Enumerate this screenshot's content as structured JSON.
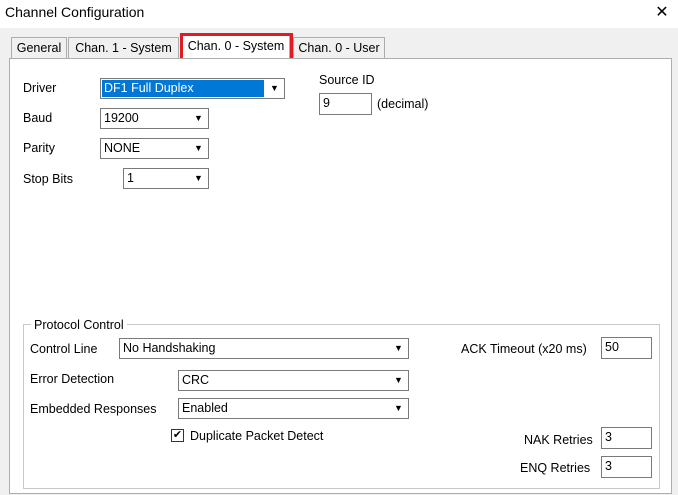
{
  "window": {
    "title": "Channel Configuration",
    "close_glyph": "✕"
  },
  "tabs": [
    {
      "label": "General"
    },
    {
      "label": "Chan. 1 - System"
    },
    {
      "label": "Chan. 0 - System",
      "active": true,
      "highlighted": true
    },
    {
      "label": "Chan. 0 - User"
    }
  ],
  "fields": {
    "driver": {
      "label": "Driver",
      "value": "DF1 Full Duplex"
    },
    "baud": {
      "label": "Baud",
      "value": "19200"
    },
    "parity": {
      "label": "Parity",
      "value": "NONE"
    },
    "stop_bits": {
      "label": "Stop Bits",
      "value": "1"
    },
    "source_id": {
      "label": "Source ID",
      "value": "9",
      "unit": "(decimal)"
    }
  },
  "protocol_control": {
    "title": "Protocol Control",
    "control_line": {
      "label": "Control Line",
      "value": "No Handshaking"
    },
    "error_detection": {
      "label": "Error Detection",
      "value": "CRC"
    },
    "embedded_responses": {
      "label": "Embedded Responses",
      "value": "Enabled"
    },
    "duplicate_packet_detect": {
      "label": "Duplicate Packet Detect",
      "checked": true,
      "check_glyph": "✔"
    },
    "ack_timeout": {
      "label": "ACK Timeout (x20 ms)",
      "value": "50"
    },
    "nak_retries": {
      "label": "NAK Retries",
      "value": "3"
    },
    "enq_retries": {
      "label": "ENQ Retries",
      "value": "3"
    }
  },
  "icons": {
    "dropdown_arrow": "▼"
  },
  "colors": {
    "highlight_border": "#e21b23",
    "selection": "#0078d7"
  }
}
